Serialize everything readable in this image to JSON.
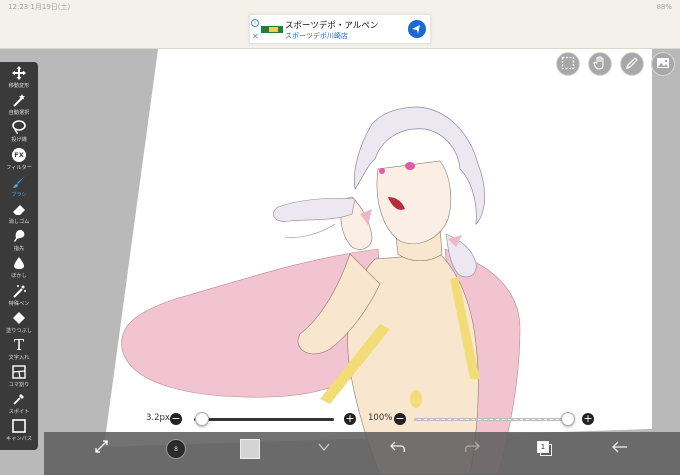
{
  "statusbar": {
    "time": "12:23",
    "date": "1月19日(土)",
    "battery": "88%"
  },
  "ad": {
    "title": "スポーツデポ・アルペン",
    "subtitle": "スポーツデポ川崎店",
    "close": "✕",
    "info": "i"
  },
  "toolbar": {
    "items": [
      {
        "label": "移動変形",
        "icon": "move-icon"
      },
      {
        "label": "自動選択",
        "icon": "magic-wand-icon"
      },
      {
        "label": "投げ縄",
        "icon": "lasso-icon"
      },
      {
        "label": "フィルター",
        "icon": "fx-icon",
        "glyph": "FX"
      },
      {
        "label": "ブラシ",
        "icon": "brush-icon",
        "active": true
      },
      {
        "label": "消しゴム",
        "icon": "eraser-icon"
      },
      {
        "label": "指先",
        "icon": "finger-icon"
      },
      {
        "label": "ぼかし",
        "icon": "blur-icon"
      },
      {
        "label": "特殊ペン",
        "icon": "special-pen-icon"
      },
      {
        "label": "塗りつぶし",
        "icon": "bucket-icon"
      },
      {
        "label": "文字入れ",
        "icon": "text-icon",
        "glyph": "T"
      },
      {
        "label": "コマ割り",
        "icon": "frame-divider-icon"
      },
      {
        "label": "スポイト",
        "icon": "eyedropper-icon"
      },
      {
        "label": "キャンバス",
        "icon": "canvas-icon"
      }
    ]
  },
  "sliders": {
    "brush_size": {
      "label": "3.2px",
      "level": 0.04
    },
    "opacity": {
      "label": "100%",
      "level": 1.0
    },
    "minus": "−",
    "plus": "+"
  },
  "bottombar": {
    "brush_number": "8",
    "layer_count": "1"
  },
  "colors": {
    "toolbar_bg": "#3a3a3a",
    "active_tool": "#4aa2e8",
    "primary_color": "#2b2b2b",
    "secondary_color": "#d4d4d4"
  }
}
